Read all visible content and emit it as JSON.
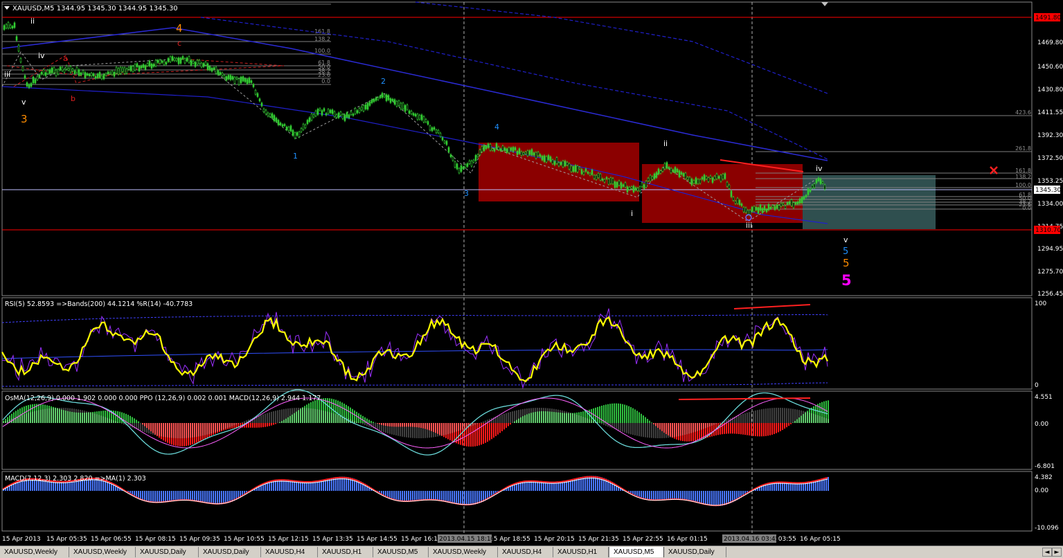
{
  "main_chart": {
    "header": "XAUUSD,M5  1344.95 1345.30 1344.95 1345.30",
    "price_labels": [
      "1491.80",
      "1469.80",
      "1450.60",
      "1430.80",
      "1411.55",
      "1392.30",
      "1372.50",
      "1353.25",
      "1345.30",
      "1334.00",
      "1314.75",
      "1310.70",
      "1294.95",
      "1275.70",
      "1256.45"
    ],
    "current_price": "1345.30",
    "top_line_price": "1491.80",
    "bottom_line_price": "1310.70",
    "fib_levels_top": [
      "161.8",
      "138.2",
      "100.0",
      "61.8",
      "50.0",
      "38.2",
      "23.6",
      "0.0"
    ],
    "fib_levels_right": [
      "423.6",
      "261.8",
      "161.8",
      "138.2",
      "100.0",
      "61.8",
      "50.0",
      "38.2",
      "23.6",
      "0.0"
    ],
    "wave_labels": {
      "ii_top": "ii",
      "iv_top": "iv",
      "iii_left": "iii",
      "v_left": "v",
      "three_orange": "3",
      "four_orange": "4",
      "a_red": "a",
      "b_red": "b",
      "c_red": "c",
      "one_blue": "1",
      "two_blue": "2",
      "three_blue": "3",
      "four_blue": "4",
      "i_white": "i",
      "ii_white": "ii",
      "iii_white": "iii",
      "iv_white": "iv",
      "v_white": "v",
      "five_blue": "5",
      "five_orange": "5",
      "five_magenta": "5"
    },
    "colors": {
      "candles": "#32cd32",
      "channel": "#2020cc",
      "red_box": "#8b0000",
      "target_box": "#2f4f4f",
      "red_line": "#ff0000",
      "sr_line": "#c0c0ff"
    },
    "icons": {
      "target_marker": "red-x-icon",
      "scroll_arrow": "triangle-down-icon"
    }
  },
  "rsi_panel": {
    "label": "RSI(5) 52.8593  =>Bands(200) 44.1214  %R(14) -40.7783",
    "scale_top": "100",
    "scale_bottom": "0"
  },
  "osma_panel": {
    "label": "OsMA(12,26,9) 0.000 1.902 0.000 0.000  PPO (12,26,9) 0.002 0.001  MACD(12,26,9) 2.944 1.177",
    "scale": [
      "4.551",
      "0.00",
      "-6.801"
    ]
  },
  "macd_panel": {
    "label": "MACD(7,12,3) 2.303 2.820  =>MA(1) 2.303",
    "scale": [
      "4.382",
      "0.00",
      "-10.096"
    ]
  },
  "time_axis": {
    "labels": [
      "15 Apr 2013",
      "15 Apr 05:35",
      "15 Apr 06:55",
      "15 Apr 08:15",
      "15 Apr 09:35",
      "15 Apr 10:55",
      "15 Apr 12:15",
      "15 Apr 13:35",
      "15 Apr 14:55",
      "15 Apr 16:15",
      "15 Apr 18:55",
      "15 Apr 20:15",
      "15 Apr 21:35",
      "15 Apr 22:55",
      "16 Apr 01:15",
      "16 Apr 03:55",
      "16 Apr 05:15"
    ],
    "crosshair_labels": [
      "2013.04.15 18:10",
      "2013.04.16 03:45"
    ]
  },
  "tabs": [
    "XAUUSD,Weekly",
    "XAUUSD,Weekly",
    "XAUUSD,Daily",
    "XAUUSD,Daily",
    "XAUUSD,H4",
    "XAUUSD,H1",
    "XAUUSD,M5",
    "XAUUSD,Weekly",
    "XAUUSD,H4",
    "XAUUSD,H1",
    "XAUUSD,M5",
    "XAUUSD,Daily"
  ],
  "active_tab_index": 10,
  "tab_nav": {
    "prev": "◄",
    "next": "►"
  }
}
